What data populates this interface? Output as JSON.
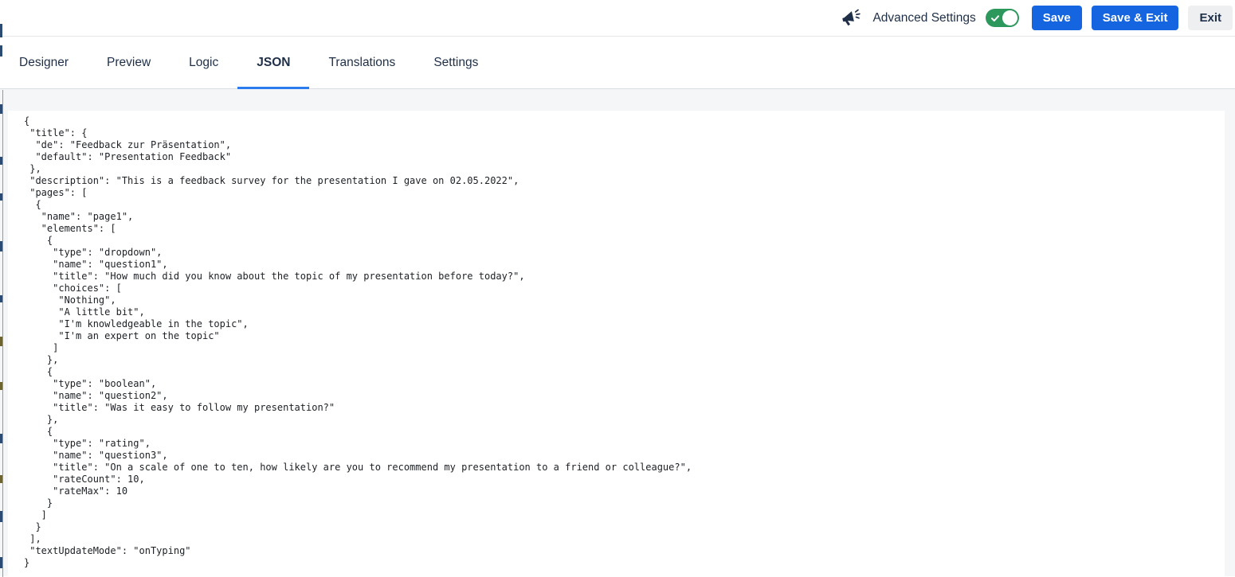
{
  "topbar": {
    "advanced_settings_label": "Advanced Settings",
    "advanced_settings_on": true,
    "save_label": "Save",
    "save_exit_label": "Save & Exit",
    "exit_label": "Exit"
  },
  "tabs": {
    "active": "JSON",
    "items": [
      {
        "label": "Designer"
      },
      {
        "label": "Preview"
      },
      {
        "label": "Logic"
      },
      {
        "label": "JSON"
      },
      {
        "label": "Translations"
      },
      {
        "label": "Settings"
      }
    ]
  },
  "icons": {
    "megaphone": "megaphone-icon",
    "toggle_check": "check-icon"
  },
  "colors": {
    "accent_blue": "#1565e0",
    "tab_underline_blue": "#2b7cee",
    "toggle_green": "#2c985c",
    "navy_text": "#1e2f47",
    "page_background": "#f5f6f8",
    "editor_background": "#ffffff",
    "code_text": "#1c2025"
  },
  "editor": {
    "language": "json",
    "json_lines": [
      "{",
      " \"title\": {",
      "  \"de\": \"Feedback zur Präsentation\",",
      "  \"default\": \"Presentation Feedback\"",
      " },",
      " \"description\": \"This is a feedback survey for the presentation I gave on 02.05.2022\",",
      " \"pages\": [",
      "  {",
      "   \"name\": \"page1\",",
      "   \"elements\": [",
      "    {",
      "     \"type\": \"dropdown\",",
      "     \"name\": \"question1\",",
      "     \"title\": \"How much did you know about the topic of my presentation before today?\",",
      "     \"choices\": [",
      "      \"Nothing\",",
      "      \"A little bit\",",
      "      \"I'm knowledgeable in the topic\",",
      "      \"I'm an expert on the topic\"",
      "     ]",
      "    },",
      "    {",
      "     \"type\": \"boolean\",",
      "     \"name\": \"question2\",",
      "     \"title\": \"Was it easy to follow my presentation?\"",
      "    },",
      "    {",
      "     \"type\": \"rating\",",
      "     \"name\": \"question3\",",
      "     \"title\": \"On a scale of one to ten, how likely are you to recommend my presentation to a friend or colleague?\",",
      "     \"rateCount\": 10,",
      "     \"rateMax\": 10",
      "    }",
      "   ]",
      "  }",
      " ],",
      " \"textUpdateMode\": \"onTyping\"",
      "}"
    ]
  }
}
